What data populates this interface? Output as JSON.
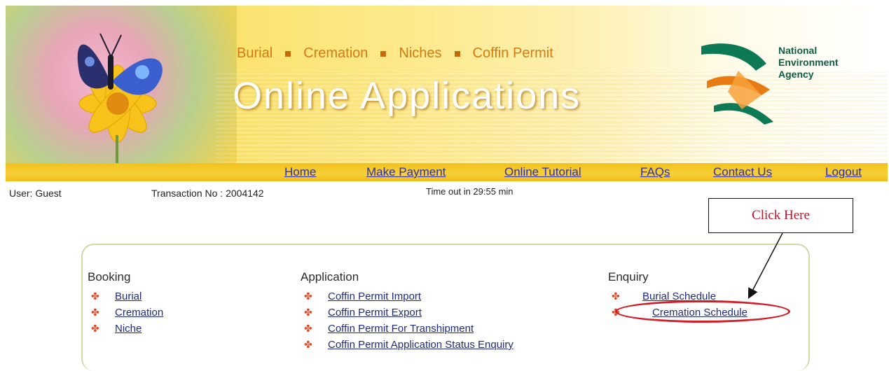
{
  "banner": {
    "nav_items": [
      "Burial",
      "Cremation",
      "Niches",
      "Coffin Permit"
    ],
    "title": "Online Applications",
    "agency_name": [
      "National",
      "Environment",
      "Agency"
    ]
  },
  "navbar": {
    "items": [
      "Home",
      "Make Payment",
      "Online Tutorial",
      "FAQs",
      "Contact Us",
      "Logout"
    ]
  },
  "info": {
    "user": "User: Guest",
    "transaction": "Transaction No : 2004142",
    "timeout": "Time out in 29:55 min"
  },
  "sections": [
    {
      "title": "Booking",
      "links": [
        "Burial",
        "Cremation",
        "Niche"
      ]
    },
    {
      "title": "Application",
      "links": [
        "Coffin Permit Import",
        "Coffin Permit Export",
        "Coffin Permit For Transhipment",
        "Coffin Permit Application Status Enquiry"
      ]
    },
    {
      "title": "Enquiry",
      "links": [
        "Burial Schedule",
        "Cremation Schedule"
      ]
    }
  ],
  "annotation": {
    "callout": "Click Here"
  },
  "colors": {
    "accent": "#f2c21c",
    "link": "#1f2b7a",
    "bullet": "#e04b26",
    "annotation": "#d21d28"
  },
  "icons": {
    "bullet": "cross-bullet-icon",
    "logo": "nea-logo-icon",
    "banner_art": "butterfly-flower-image"
  }
}
